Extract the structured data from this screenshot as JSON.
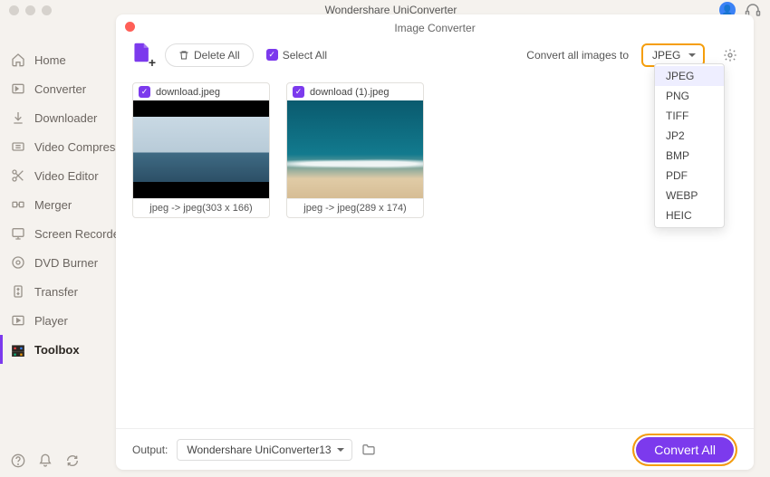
{
  "app_title": "Wondershare UniConverter",
  "panel_title": "Image Converter",
  "sidebar": {
    "items": [
      {
        "label": "Home",
        "icon": "home"
      },
      {
        "label": "Converter",
        "icon": "converter"
      },
      {
        "label": "Downloader",
        "icon": "downloader"
      },
      {
        "label": "Video Compress",
        "icon": "compress"
      },
      {
        "label": "Video Editor",
        "icon": "scissors"
      },
      {
        "label": "Merger",
        "icon": "merger"
      },
      {
        "label": "Screen Recorder",
        "icon": "screen"
      },
      {
        "label": "DVD Burner",
        "icon": "dvd"
      },
      {
        "label": "Transfer",
        "icon": "transfer"
      },
      {
        "label": "Player",
        "icon": "player"
      },
      {
        "label": "Toolbox",
        "icon": "toolbox"
      }
    ],
    "active_index": 10
  },
  "toolbar": {
    "delete_all": "Delete All",
    "select_all": "Select All",
    "convert_label": "Convert all images to",
    "format_selected": "JPEG",
    "format_options": [
      "JPEG",
      "PNG",
      "TIFF",
      "JP2",
      "BMP",
      "PDF",
      "WEBP",
      "HEIC"
    ]
  },
  "thumbs": [
    {
      "filename": "download.jpeg",
      "info": "jpeg -> jpeg(303 x 166)"
    },
    {
      "filename": "download (1).jpeg",
      "info": "jpeg -> jpeg(289 x 174)"
    }
  ],
  "output": {
    "label": "Output:",
    "path": "Wondershare UniConverter13"
  },
  "convert_all": "Convert All"
}
